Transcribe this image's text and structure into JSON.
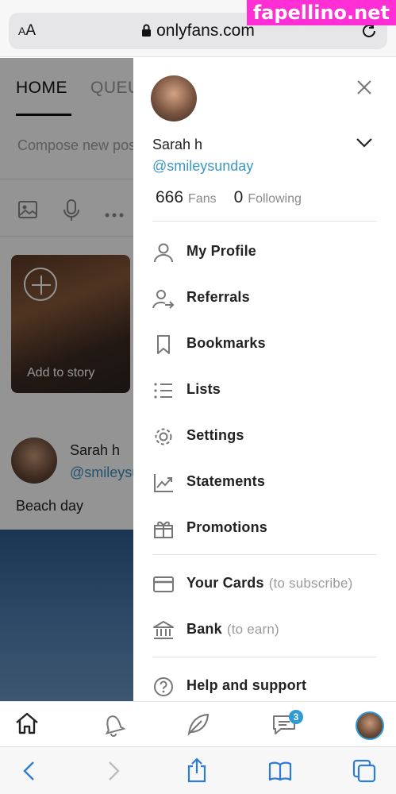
{
  "browser": {
    "text_size_label": "AA",
    "url": "onlyfans.com",
    "watermark": "fapellino.net"
  },
  "feed": {
    "tabs": [
      "HOME",
      "QUEUE"
    ],
    "compose_placeholder": "Compose new post...",
    "story_label": "Add to story",
    "post": {
      "author_name": "Sarah h",
      "author_handle": "@smileysunday",
      "text": "Beach day"
    }
  },
  "drawer": {
    "name": "Sarah h",
    "handle": "@smileysunday",
    "fans_count": "666",
    "fans_label": "Fans",
    "following_count": "0",
    "following_label": "Following",
    "items": [
      {
        "label": "My Profile",
        "icon": "user-icon"
      },
      {
        "label": "Referrals",
        "icon": "referrals-icon"
      },
      {
        "label": "Bookmarks",
        "icon": "bookmark-icon"
      },
      {
        "label": "Lists",
        "icon": "list-icon"
      },
      {
        "label": "Settings",
        "icon": "gear-icon"
      },
      {
        "label": "Statements",
        "icon": "chart-icon"
      },
      {
        "label": "Promotions",
        "icon": "gift-icon"
      },
      {
        "label": "Your Cards",
        "sub": "(to subscribe)",
        "icon": "card-icon"
      },
      {
        "label": "Bank",
        "sub": "(to earn)",
        "icon": "bank-icon"
      },
      {
        "label": "Help and support",
        "icon": "help-icon"
      }
    ]
  },
  "appnav": {
    "messages_badge": "3"
  },
  "colors": {
    "accent": "#2e9bd6",
    "handle": "#3a98c9",
    "watermark_bg": "#ff2fd5"
  }
}
